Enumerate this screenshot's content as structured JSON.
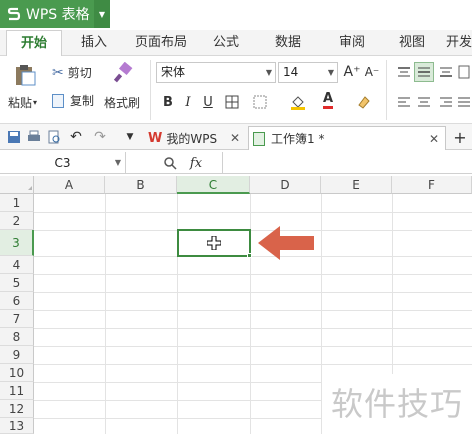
{
  "app": {
    "name": "WPS 表格",
    "brand_color": "#4a9a4f"
  },
  "ribbon_tabs": [
    {
      "label": "开始",
      "active": true
    },
    {
      "label": "插入",
      "active": false
    },
    {
      "label": "页面布局",
      "active": false
    },
    {
      "label": "公式",
      "active": false
    },
    {
      "label": "数据",
      "active": false
    },
    {
      "label": "审阅",
      "active": false
    },
    {
      "label": "视图",
      "active": false
    },
    {
      "label": "开发",
      "active": false
    }
  ],
  "ribbon": {
    "paste_label": "粘贴",
    "cut_label": "剪切",
    "copy_label": "复制",
    "format_painter_label": "格式刷",
    "font_name": "宋体",
    "font_size": "14",
    "bold": "B",
    "italic": "I",
    "underline": "U",
    "font_color_glyph": "A",
    "grow_font": "A⁺",
    "shrink_font": "A⁻"
  },
  "doc_tabs": [
    {
      "label": "我的WPS",
      "active": false
    },
    {
      "label": "工作簿1 *",
      "active": true
    }
  ],
  "formula_bar": {
    "name_box": "C3",
    "fx": "fx"
  },
  "grid": {
    "columns": [
      "A",
      "B",
      "C",
      "D",
      "E",
      "F"
    ],
    "selected_column": "C",
    "rows": [
      "1",
      "2",
      "3",
      "4",
      "5",
      "6",
      "7",
      "8",
      "9",
      "10",
      "11",
      "12",
      "13"
    ],
    "selected_row": "3",
    "active_cell": "C3"
  },
  "annotation": {
    "arrow_color": "#d9634a"
  },
  "watermark": "软件技巧"
}
